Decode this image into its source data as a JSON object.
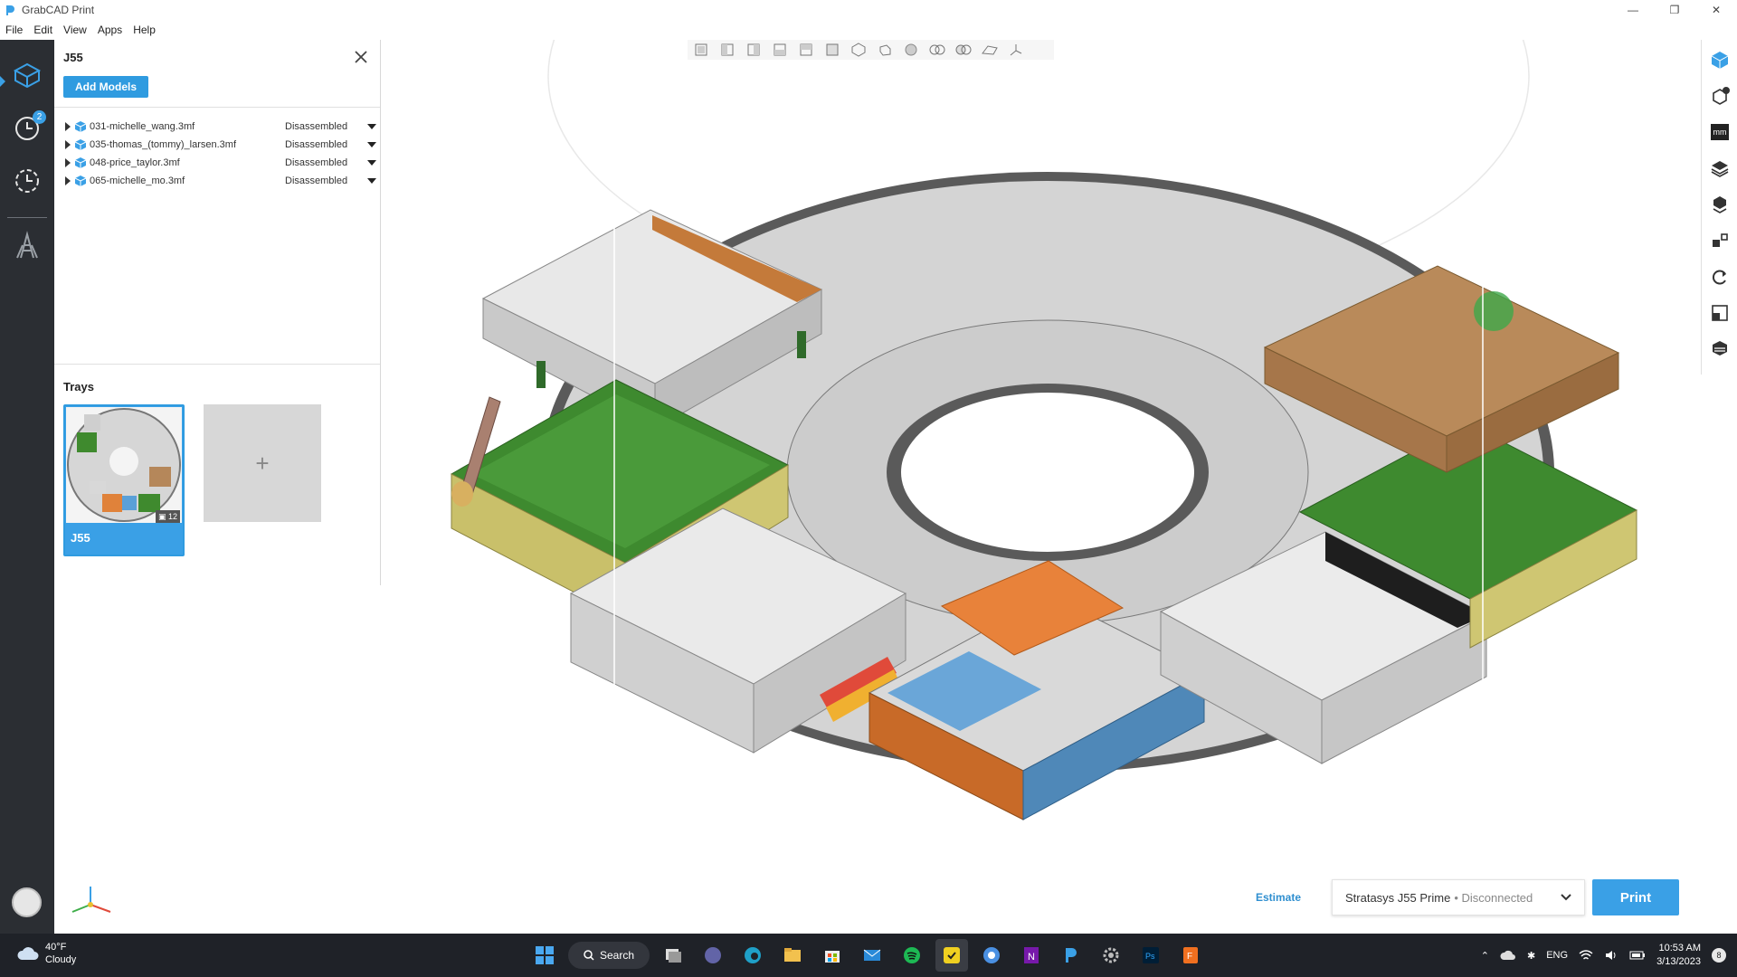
{
  "window": {
    "title": "GrabCAD Print",
    "controls": [
      "minimize",
      "restore",
      "close"
    ]
  },
  "menu": [
    "File",
    "Edit",
    "View",
    "Apps",
    "Help"
  ],
  "left_rail": {
    "items": [
      {
        "icon": "tray-layout-icon",
        "active": true
      },
      {
        "icon": "history-clock-icon",
        "badge": "2"
      },
      {
        "icon": "schedule-clock-icon"
      },
      {
        "icon": "printer-tower-icon"
      }
    ],
    "avatar": "avatar"
  },
  "panel": {
    "job_title": "J55",
    "add_models_label": "Add Models",
    "models": [
      {
        "name": "031-michelle_wang.3mf",
        "status": "Disassembled"
      },
      {
        "name": "035-thomas_(tommy)_larsen.3mf",
        "status": "Disassembled"
      },
      {
        "name": "048-price_taylor.3mf",
        "status": "Disassembled"
      },
      {
        "name": "065-michelle_mo.3mf",
        "status": "Disassembled"
      }
    ],
    "trays_title": "Trays",
    "tray": {
      "label": "J55",
      "model_count": "12"
    },
    "add_tray_label": "+"
  },
  "view_toolbar": {
    "icons": [
      "front-view-icon",
      "back-view-icon",
      "left-view-icon",
      "right-view-icon",
      "top-view-icon",
      "iso-view-icon",
      "wireframe-icon",
      "shaded-icon",
      "multi-view-icon",
      "transparent-view-icon",
      "outline-view-icon",
      "axis-view-icon"
    ]
  },
  "right_rail": {
    "icons": [
      "model-cube-icon",
      "check-cube-icon",
      "mm-units-icon",
      "layers-icon",
      "stack-icon",
      "align-icon",
      "rotate-icon",
      "scale-icon",
      "slice-icon"
    ],
    "mm_label": "mm"
  },
  "print_bar": {
    "estimate_label": "Estimate",
    "printer_name": "Stratasys J55 Prime",
    "printer_status": "• Disconnected",
    "print_label": "Print"
  },
  "taskbar": {
    "weather_temp": "40°F",
    "weather_desc": "Cloudy",
    "search_label": "Search",
    "apps": [
      "start-icon",
      "search",
      "task-view-icon",
      "teams-icon",
      "edge-icon",
      "explorer-icon",
      "store-icon",
      "mail-icon",
      "spotify-icon",
      "grabcad-icon",
      "chrome-icon",
      "onenote-icon",
      "grabcad-print-icon",
      "settings-icon",
      "photoshop-icon",
      "files-icon"
    ],
    "lang": "ENG",
    "time": "10:53 AM",
    "date": "3/13/2023",
    "notification_count": "8"
  },
  "colors": {
    "accent": "#3aa0e6",
    "rail_bg": "#2b2e33",
    "taskbar_bg": "#1f2228",
    "tray_floor": "#d2d2d2",
    "tray_rim": "#575757"
  }
}
